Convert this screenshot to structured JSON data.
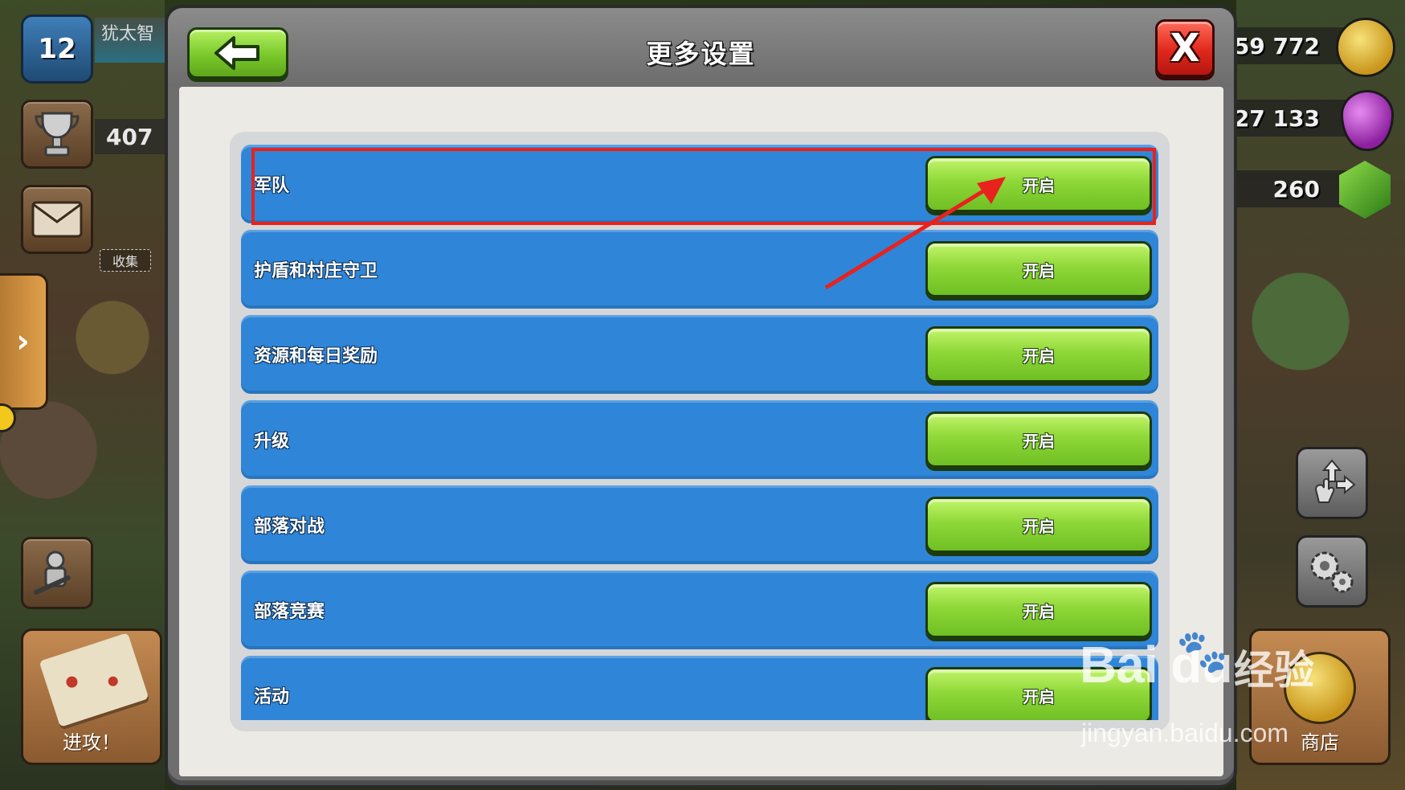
{
  "hud": {
    "level": "12",
    "player_name": "犹太智",
    "trophies": "407",
    "collect_label": "收集",
    "side_tab_arrow": "›",
    "attack_label": "进攻！",
    "shop_label": "商店"
  },
  "resources": {
    "gold": "59 772",
    "elixir": "27 133",
    "gems": "260",
    "gold_icon": "gold-coin-icon",
    "elixir_icon": "elixir-drop-icon",
    "gem_icon": "gem-icon"
  },
  "dialog": {
    "title": "更多设置",
    "close_label": "X",
    "back_icon": "back-arrow-icon",
    "settings": [
      {
        "label": "军队",
        "button": "开启"
      },
      {
        "label": "护盾和村庄守卫",
        "button": "开启"
      },
      {
        "label": "资源和每日奖励",
        "button": "开启"
      },
      {
        "label": "升级",
        "button": "开启"
      },
      {
        "label": "部落对战",
        "button": "开启"
      },
      {
        "label": "部落竞赛",
        "button": "开启"
      },
      {
        "label": "活动",
        "button": "开启"
      }
    ]
  },
  "annotation": {
    "color": "#e8221c"
  },
  "watermark": {
    "brand": "Bai du",
    "cn": "经验",
    "url": "jingyan.baidu.com"
  },
  "colors": {
    "row_blue": "#2f86d8",
    "button_green": "#8fd838",
    "close_red": "#e0281c"
  }
}
